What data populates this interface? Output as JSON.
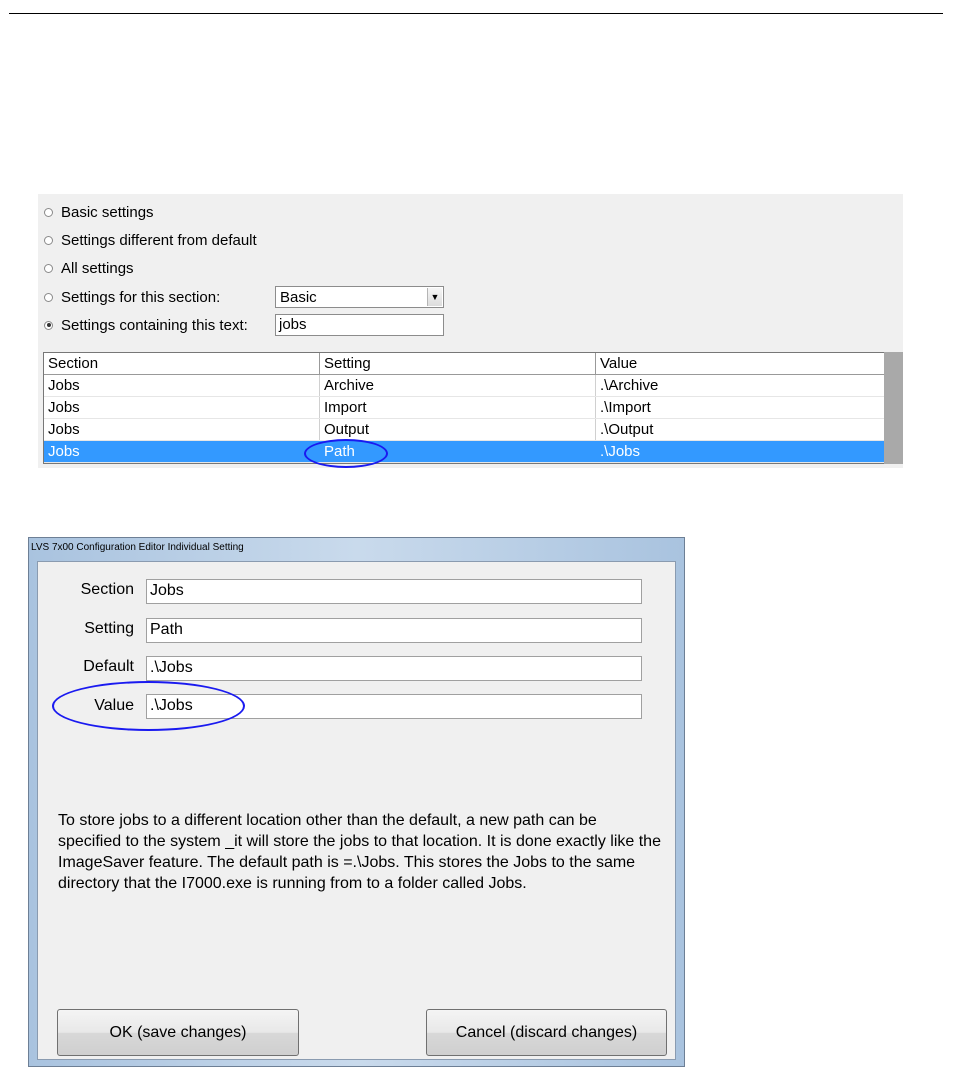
{
  "filters": {
    "options": [
      {
        "label": "Basic settings",
        "checked": false
      },
      {
        "label": "Settings different from default",
        "checked": false
      },
      {
        "label": "All settings",
        "checked": false
      },
      {
        "label": "Settings for this section:",
        "checked": false
      },
      {
        "label": "Settings containing this text:",
        "checked": true
      }
    ],
    "section_combo_value": "Basic",
    "text_filter_value": "jobs"
  },
  "grid": {
    "headers": [
      "Section",
      "Setting",
      "Value"
    ],
    "rows": [
      [
        "Jobs",
        "Archive",
        ".\\Archive"
      ],
      [
        "Jobs",
        "Import",
        ".\\Import"
      ],
      [
        "Jobs",
        "Output",
        ".\\Output"
      ],
      [
        "Jobs",
        "Path",
        ".\\Jobs"
      ]
    ],
    "selected_row": 3,
    "selected_color": "#3399ff"
  },
  "dialog": {
    "title": "LVS 7x00 Configuration Editor Individual Setting",
    "fields": [
      {
        "label": "Section",
        "value": "Jobs"
      },
      {
        "label": "Setting",
        "value": "Path"
      },
      {
        "label": "Default",
        "value": ".\\Jobs"
      },
      {
        "label": "Value",
        "value": ".\\Jobs"
      }
    ],
    "help_text": "To store jobs to a different location other than the default, a new path can be specified to the system _it will store the jobs to that location.  It is done exactly like the ImageSaver feature.  The default path is =.\\Jobs.  This stores the Jobs to the same directory that the I7000.exe is running from to a folder called Jobs.",
    "ok_label": "OK (save changes)",
    "cancel_label": "Cancel (discard changes)"
  },
  "annotation_color": "#1a1af0"
}
